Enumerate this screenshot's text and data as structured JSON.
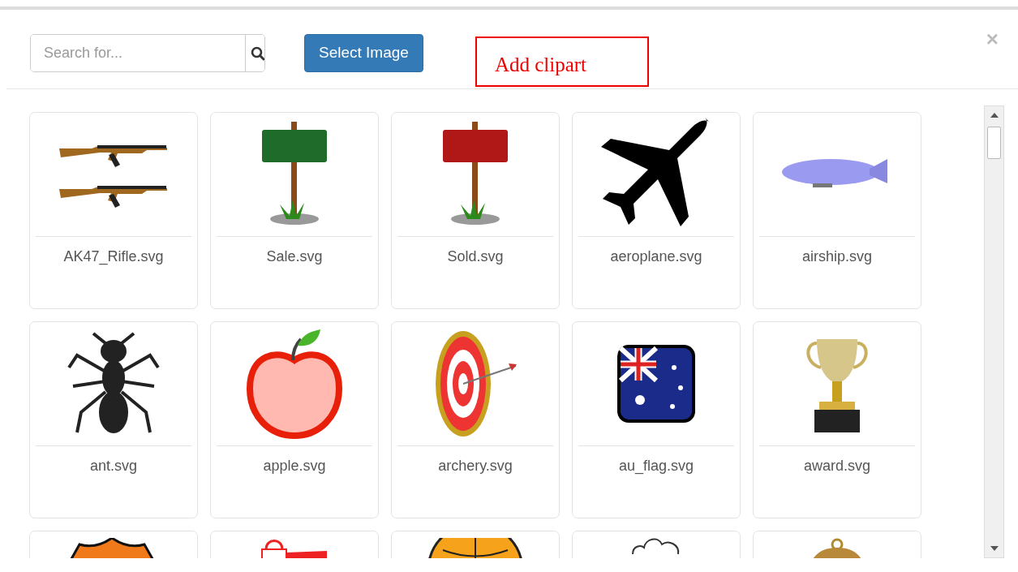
{
  "search": {
    "placeholder": "Search for..."
  },
  "select_button": {
    "label": "Select Image"
  },
  "annotation": {
    "label": "Add clipart"
  },
  "close": {
    "label": "×"
  },
  "clipart": [
    {
      "kind": "labeled",
      "label": "AK47_Rifle.svg"
    },
    {
      "kind": "labeled",
      "label": "Sale.svg"
    },
    {
      "kind": "labeled",
      "label": "Sold.svg"
    },
    {
      "kind": "labeled",
      "label": "aeroplane.svg"
    },
    {
      "kind": "labeled",
      "label": "airship.svg"
    },
    {
      "kind": "labeled",
      "label": "ant.svg"
    },
    {
      "kind": "labeled",
      "label": "apple.svg"
    },
    {
      "kind": "labeled",
      "label": "archery.svg"
    },
    {
      "kind": "labeled",
      "label": "au_flag.svg"
    },
    {
      "kind": "labeled",
      "label": "award.svg"
    },
    {
      "kind": "cut"
    },
    {
      "kind": "cut"
    },
    {
      "kind": "cut"
    },
    {
      "kind": "cut"
    },
    {
      "kind": "cut"
    }
  ]
}
